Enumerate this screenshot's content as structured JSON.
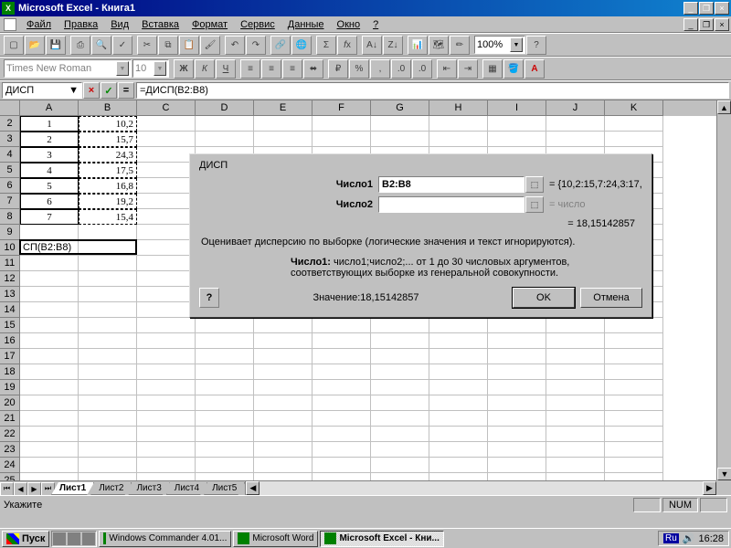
{
  "app": {
    "title": "Microsoft Excel - Книга1"
  },
  "menu": [
    "Файл",
    "Правка",
    "Вид",
    "Вставка",
    "Формат",
    "Сервис",
    "Данные",
    "Окно",
    "?"
  ],
  "toolbar2": {
    "font": "Times New Roman",
    "size": "10",
    "zoom": "100%"
  },
  "formula_bar": {
    "name_box": "ДИСП",
    "formula": "=ДИСП(B2:B8)"
  },
  "columns": [
    "A",
    "B",
    "C",
    "D",
    "E",
    "F",
    "G",
    "H",
    "I",
    "J",
    "K"
  ],
  "row_count": 25,
  "data_rows": [
    {
      "a": "1",
      "b": "10,2"
    },
    {
      "a": "2",
      "b": "15,7"
    },
    {
      "a": "3",
      "b": "24,3"
    },
    {
      "a": "4",
      "b": "17,5"
    },
    {
      "a": "5",
      "b": "16,8"
    },
    {
      "a": "6",
      "b": "19,2"
    },
    {
      "a": "7",
      "b": "15,4"
    }
  ],
  "a10": "СП(B2:B8)",
  "sheets": [
    "Лист1",
    "Лист2",
    "Лист3",
    "Лист4",
    "Лист5"
  ],
  "status": {
    "text": "Укажите",
    "ind": "NUM"
  },
  "dialog": {
    "title": "ДИСП",
    "arg1_label": "Число1",
    "arg1_value": "B2:B8",
    "arg1_eval": "= {10,2:15,7:24,3:17,",
    "arg2_label": "Число2",
    "arg2_value": "",
    "arg2_eval": "= число",
    "result": "= 18,15142857",
    "desc": "Оценивает дисперсию по выборке (логические значения и текст игнорируются).",
    "arg_name": "Число1:",
    "arg_desc1": "число1;число2;... от 1 до 30 числовых аргументов,",
    "arg_desc2": "соответствующих выборке из генеральной совокупности.",
    "value_label": "Значение:",
    "value": "18,15142857",
    "ok": "OK",
    "cancel": "Отмена"
  },
  "taskbar": {
    "start": "Пуск",
    "tasks": [
      {
        "label": "Windows Commander 4.01...",
        "active": false
      },
      {
        "label": "Microsoft Word",
        "active": false
      },
      {
        "label": "Microsoft Excel - Кни...",
        "active": true
      }
    ],
    "lang": "Ru",
    "time": "16:28"
  }
}
